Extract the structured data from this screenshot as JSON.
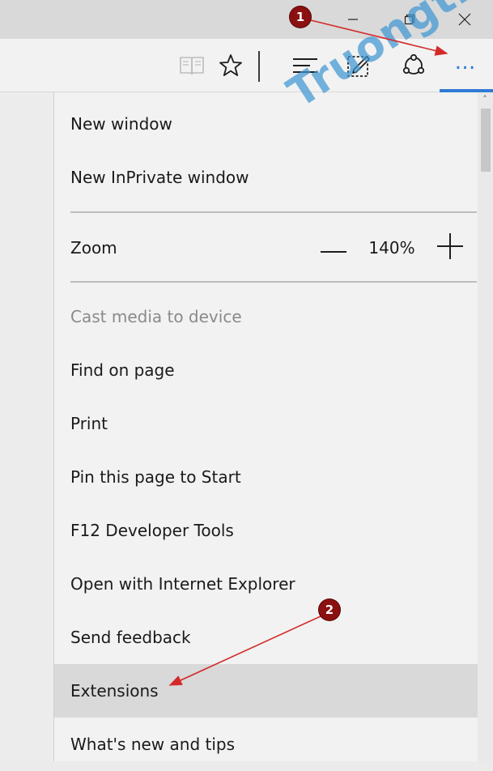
{
  "titlebar": {
    "minimize_icon": "minimize-icon",
    "restore_icon": "restore-icon",
    "close_icon": "close-icon"
  },
  "toolbar": {
    "icons": [
      "reading-view-icon",
      "favorites-star-icon",
      "hub-icon",
      "web-note-icon",
      "share-icon",
      "more-actions-icon"
    ],
    "more_label": "…"
  },
  "menu": {
    "new_window": "New window",
    "new_inprivate": "New InPrivate window",
    "zoom_label": "Zoom",
    "zoom_value": "140%",
    "zoom_minus": "—",
    "zoom_plus": "+",
    "cast_media": "Cast media to device",
    "find_on_page": "Find on page",
    "print": "Print",
    "pin_to_start": "Pin this page to Start",
    "dev_tools": "F12 Developer Tools",
    "open_ie": "Open with Internet Explorer",
    "send_feedback": "Send feedback",
    "extensions": "Extensions",
    "whats_new": "What's new and tips"
  },
  "annotations": {
    "step1": "1",
    "step2": "2",
    "arrow_color": "#d42a2a",
    "badge_color": "#8b1010"
  },
  "watermark": "Truongtin.top",
  "colors": {
    "accent": "#2f7bd6",
    "menu_bg": "#f2f2f2",
    "highlight_bg": "#d9d9d9",
    "disabled_text": "#8a8a8a"
  }
}
